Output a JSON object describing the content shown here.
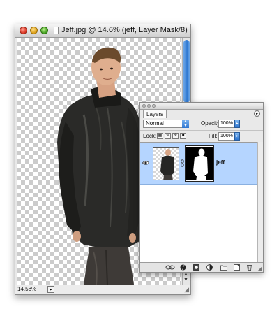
{
  "document": {
    "title": "Jeff.jpg @ 14.6% (jeff, Layer Mask/8)",
    "zoom": "14.58%"
  },
  "layers_panel": {
    "tab_label": "Layers",
    "blend_mode": "Normal",
    "opacity_label": "Opacity:",
    "opacity_value": "100%",
    "lock_label": "Lock:",
    "fill_label": "Fill:",
    "fill_value": "100%",
    "layers": [
      {
        "name": "jeff",
        "visible": true,
        "has_mask": true,
        "selected": true
      }
    ],
    "bottom_buttons": [
      "link-layers",
      "layer-style",
      "add-layer-mask",
      "new-adjustment-layer",
      "new-group",
      "new-layer",
      "delete-layer"
    ]
  },
  "colors": {
    "selected_row": "#b5d5ff",
    "scroll_thumb": "#2e78d1"
  }
}
